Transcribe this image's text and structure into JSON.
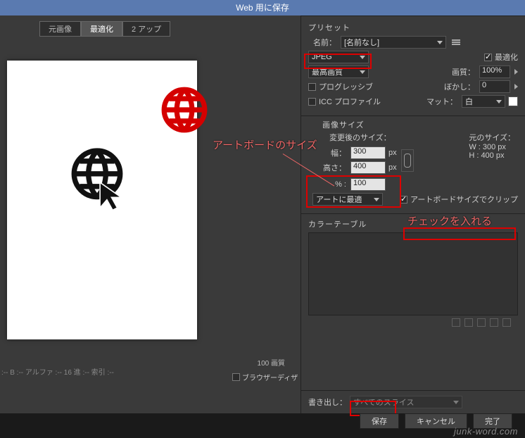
{
  "window": {
    "title": "Web 用に保存"
  },
  "tabs": {
    "original": "元画像",
    "optimized": "最適化",
    "two_up": "2 アップ"
  },
  "canvas": {
    "quality_label": "100 画質"
  },
  "preset": {
    "title": "プリセット",
    "name_lbl": "名前：",
    "name_val": "[名前なし]",
    "format": "JPEG",
    "optimize_lbl": "最適化",
    "quality_sel": "最高画質",
    "quality_lbl": "画質：",
    "quality_val": "100%",
    "progressive": "プログレッシブ",
    "blur_lbl": "ぼかし：",
    "blur_val": "0",
    "icc": "ICC プロファイル",
    "matte_lbl": "マット：",
    "matte_val": "白"
  },
  "image_size": {
    "title": "画像サイズ",
    "changed_title": "変更後のサイズ：",
    "w_lbl": "幅：",
    "w": "300",
    "px": "px",
    "h_lbl": "高さ：",
    "h": "400",
    "pct_lbl": "% :",
    "pct": "100",
    "art_optimize": "アートに最適",
    "orig_title": "元のサイズ：",
    "orig_w": "W :  300 px",
    "orig_h": "H :  400 px",
    "clip_artboard": "アートボードサイズでクリップ"
  },
  "color_table": {
    "title": "カラーテーブル"
  },
  "export": {
    "lbl": "書き出し：",
    "val": "すべてのスライス"
  },
  "browser_dither": "ブラウザーディザ",
  "status": ":-- B :-- アルファ :-- 16 進 :-- 索引 :--",
  "buttons": {
    "save": "保存",
    "cancel": "キャンセル",
    "done": "完了"
  },
  "annotations": {
    "a1": "アートボードのサイズ",
    "a2": "チェックを入れる"
  },
  "watermark": "junk-word.com"
}
